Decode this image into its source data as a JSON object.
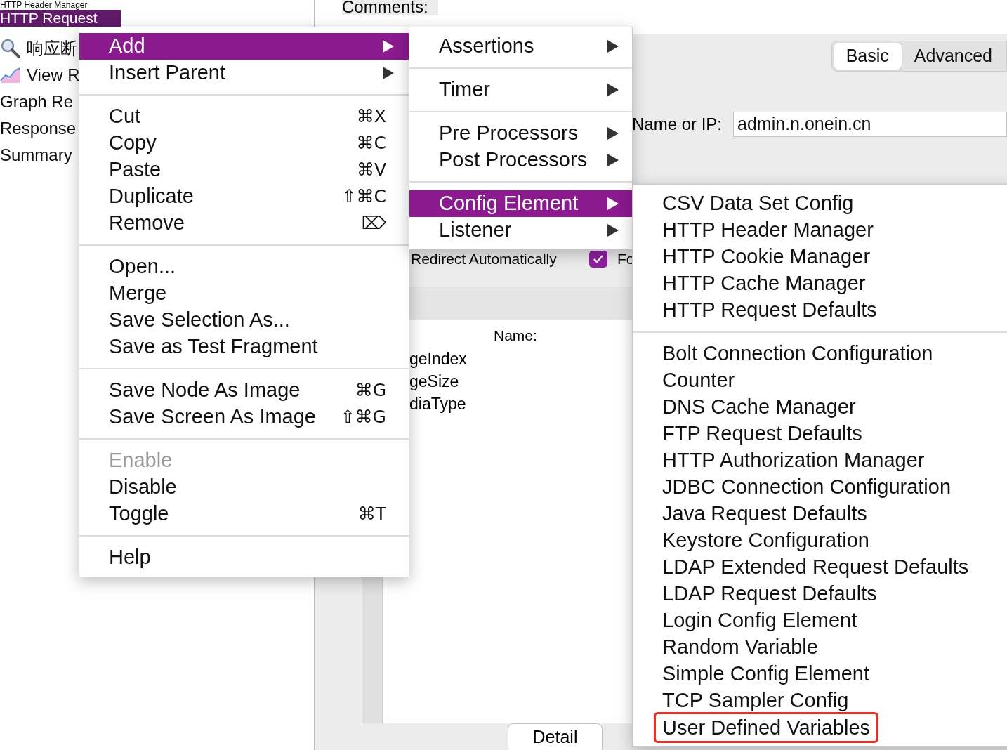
{
  "tree": {
    "partial_item": "HTTP Header Manager",
    "items": [
      {
        "label": "HTTP Request",
        "selected": true
      },
      {
        "label": "响应断",
        "selected": false
      },
      {
        "label": "View R",
        "selected": false
      },
      {
        "label": "Graph Re",
        "selected": false
      },
      {
        "label": "Response",
        "selected": false
      },
      {
        "label": "Summary",
        "selected": false
      }
    ]
  },
  "panel": {
    "comments_label": "Comments:",
    "tabs": [
      {
        "label": "Basic",
        "selected": true
      },
      {
        "label": "Advanced",
        "selected": false
      }
    ],
    "server_label": "Name or IP:",
    "server_value": "admin.n.onein.cn",
    "redirect": {
      "label": "Redirect Automatically",
      "checked": true
    },
    "follow_label": "Fo",
    "params_name_header": "Name:",
    "params": [
      "geIndex",
      "geSize",
      "diaType"
    ],
    "detail_button": "Detail"
  },
  "context_menu": {
    "groups": [
      [
        {
          "label": "Add",
          "submenu": true,
          "selected": true,
          "disabled": false
        },
        {
          "label": "Insert Parent",
          "submenu": true,
          "selected": false,
          "disabled": false
        }
      ],
      [
        {
          "label": "Cut",
          "shortcut": "⌘X",
          "submenu": false,
          "selected": false,
          "disabled": false
        },
        {
          "label": "Copy",
          "shortcut": "⌘C",
          "submenu": false,
          "selected": false,
          "disabled": false
        },
        {
          "label": "Paste",
          "shortcut": "⌘V",
          "submenu": false,
          "selected": false,
          "disabled": false
        },
        {
          "label": "Duplicate",
          "shortcut": "⇧⌘C",
          "submenu": false,
          "selected": false,
          "disabled": false
        },
        {
          "label": "Remove",
          "shortcut": "⌦",
          "submenu": false,
          "selected": false,
          "disabled": false
        }
      ],
      [
        {
          "label": "Open...",
          "submenu": false,
          "selected": false,
          "disabled": false
        },
        {
          "label": "Merge",
          "submenu": false,
          "selected": false,
          "disabled": false
        },
        {
          "label": "Save Selection As...",
          "submenu": false,
          "selected": false,
          "disabled": false
        },
        {
          "label": "Save as Test Fragment",
          "submenu": false,
          "selected": false,
          "disabled": false
        }
      ],
      [
        {
          "label": "Save Node As Image",
          "shortcut": "⌘G",
          "submenu": false,
          "selected": false,
          "disabled": false
        },
        {
          "label": "Save Screen As Image",
          "shortcut": "⇧⌘G",
          "submenu": false,
          "selected": false,
          "disabled": false
        }
      ],
      [
        {
          "label": "Enable",
          "submenu": false,
          "selected": false,
          "disabled": true
        },
        {
          "label": "Disable",
          "submenu": false,
          "selected": false,
          "disabled": false
        },
        {
          "label": "Toggle",
          "shortcut": "⌘T",
          "submenu": false,
          "selected": false,
          "disabled": false
        }
      ],
      [
        {
          "label": "Help",
          "submenu": false,
          "selected": false,
          "disabled": false
        }
      ]
    ]
  },
  "add_menu": {
    "groups": [
      [
        {
          "label": "Assertions",
          "submenu": true,
          "selected": false,
          "disabled": false
        }
      ],
      [
        {
          "label": "Timer",
          "submenu": true,
          "selected": false,
          "disabled": false
        }
      ],
      [
        {
          "label": "Pre Processors",
          "submenu": true,
          "selected": false,
          "disabled": false
        },
        {
          "label": "Post Processors",
          "submenu": true,
          "selected": false,
          "disabled": false
        }
      ],
      [
        {
          "label": "Config Element",
          "submenu": true,
          "selected": true,
          "disabled": false
        },
        {
          "label": "Listener",
          "submenu": true,
          "selected": false,
          "disabled": false
        }
      ]
    ]
  },
  "config_menu": {
    "groups": [
      [
        {
          "label": "CSV Data Set Config",
          "annotated": false
        },
        {
          "label": "HTTP Header Manager",
          "annotated": false
        },
        {
          "label": "HTTP Cookie Manager",
          "annotated": false
        },
        {
          "label": "HTTP Cache Manager",
          "annotated": false
        },
        {
          "label": "HTTP Request Defaults",
          "annotated": false
        }
      ],
      [
        {
          "label": "Bolt Connection Configuration",
          "annotated": false
        },
        {
          "label": "Counter",
          "annotated": false
        },
        {
          "label": "DNS Cache Manager",
          "annotated": false
        },
        {
          "label": "FTP Request Defaults",
          "annotated": false
        },
        {
          "label": "HTTP Authorization Manager",
          "annotated": false
        },
        {
          "label": "JDBC Connection Configuration",
          "annotated": false
        },
        {
          "label": "Java Request Defaults",
          "annotated": false
        },
        {
          "label": "Keystore Configuration",
          "annotated": false
        },
        {
          "label": "LDAP Extended Request Defaults",
          "annotated": false
        },
        {
          "label": "LDAP Request Defaults",
          "annotated": false
        },
        {
          "label": "Login Config Element",
          "annotated": false
        },
        {
          "label": "Random Variable",
          "annotated": false
        },
        {
          "label": "Simple Config Element",
          "annotated": false
        },
        {
          "label": "TCP Sampler Config",
          "annotated": false
        },
        {
          "label": "User Defined Variables",
          "annotated": true
        }
      ]
    ]
  }
}
